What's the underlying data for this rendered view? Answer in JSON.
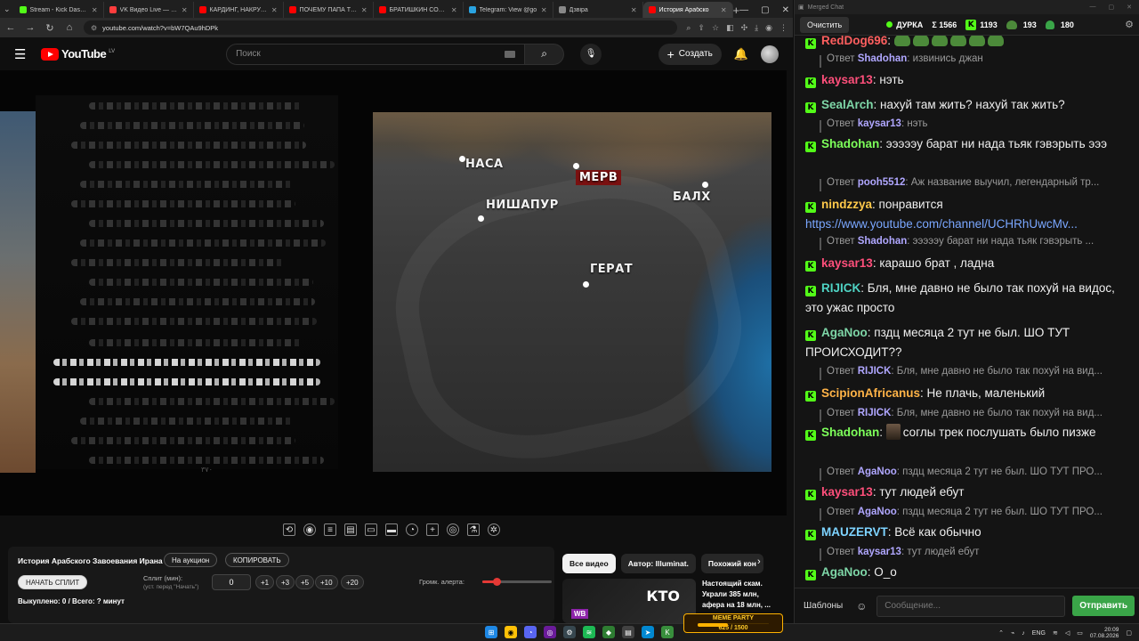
{
  "browser": {
    "tabs": [
      {
        "label": "Stream - Kick Dashboard",
        "color": "#53fc18"
      },
      {
        "label": "VK Видео Live — стрим",
        "color": "#ff3d3d"
      },
      {
        "label": "КАРДИНГ, НАКРУТКА",
        "color": "#ff0000"
      },
      {
        "label": "ПОЧЕМУ ПАПА ТЕБЯ",
        "color": "#ff0000"
      },
      {
        "label": "БРАТИШКИН СОЗДАЛ",
        "color": "#ff0000"
      },
      {
        "label": "Telegram: View @go",
        "color": "#2aa3e0"
      },
      {
        "label": "Дзвіра",
        "color": "#888888"
      },
      {
        "label": "История Арабско",
        "color": "#ff0000"
      }
    ],
    "url": "youtube.com/watch?v=bW7QAu9hDPk"
  },
  "youtube": {
    "logo_text": "YouTube",
    "region": "LV",
    "search_placeholder": "Поиск",
    "create_label": "Создать"
  },
  "video": {
    "cities": [
      {
        "name": "НАСА",
        "highlight": false
      },
      {
        "name": "МЕРВ",
        "highlight": true
      },
      {
        "name": "БАЛХ",
        "highlight": false
      },
      {
        "name": "НИШАПУР",
        "highlight": false
      },
      {
        "name": "ГЕРАТ",
        "highlight": false
      }
    ],
    "page_number": "٣٧٠"
  },
  "extension": {
    "title": "История Арабского Завоевания Ирана",
    "auction_label": "На аукцион",
    "copy_label": "КОПИРОВАТЬ",
    "start_split_label": "НАЧАТЬ СПЛИТ",
    "split_label": "Сплит (мин):",
    "split_hint": "(уст. перед \"Начать\")",
    "split_value": "0",
    "steps": [
      "+1",
      "+3",
      "+5",
      "+10",
      "+20"
    ],
    "alert_volume_label": "Громк. алерта:",
    "alert_volume_fraction": 0.2,
    "footer": "Выкуплено: 0 / Всего: ? минут"
  },
  "recommendations": {
    "chips": [
      "Все видео",
      "Автор: Illuminat.",
      "Похожий кон"
    ],
    "thumb_text": "КТО",
    "thumb_tag": "WB",
    "title": "Настоящий скам. Украли 385 млн, афера на 18 млн, ..."
  },
  "chat": {
    "window_title": "Merged Chat",
    "clear_label": "Очистить",
    "channel": "ДУРКА",
    "total": "Σ 1566",
    "kick_count": "1193",
    "frog_count": "193",
    "other_count": "180",
    "reply_label": "Ответ",
    "messages": [
      {
        "type": "msg",
        "user": "RedDog696",
        "color": "#ff5f5f",
        "text": "",
        "emotes": 6
      },
      {
        "type": "reply",
        "user": "Shadohan",
        "text": "извинись джан"
      },
      {
        "type": "msg",
        "user": "kaysar13",
        "color": "#ff4f7b",
        "text": "нэть"
      },
      {
        "type": "msg",
        "user": "SealArch",
        "color": "#7ed6a7",
        "text": "нахуй там жить? нахуй так жить?"
      },
      {
        "type": "reply",
        "user": "kaysar13",
        "text": "нэть"
      },
      {
        "type": "msg",
        "user": "Shadohan",
        "color": "#7dff5a",
        "text": "эээээу барат ни нада тьяк гэвэрыть эээ"
      },
      {
        "type": "reply",
        "user": "pooh5512",
        "text": "Аж название выучил, легендарный тр..."
      },
      {
        "type": "msg",
        "user": "nindzzya",
        "color": "#ffc94a",
        "text": "понравится",
        "link": "https://www.youtube.com/channel/UCHRhUwcMv..."
      },
      {
        "type": "reply",
        "user": "Shadohan",
        "text": "эээээу барат ни нада тьяк гэвэрыть ..."
      },
      {
        "type": "msg",
        "user": "kaysar13",
        "color": "#ff4f7b",
        "text": "карашо брат ,  ладна"
      },
      {
        "type": "msg",
        "user": "RIJICK",
        "color": "#4fd3c4",
        "text": "Бля, мне давно не было так похуй на видос, это ужас просто"
      },
      {
        "type": "msg",
        "user": "AgaNoo",
        "color": "#7ed6a7",
        "text": "пздц месяца 2 тут не был. ШО ТУТ ПРОИСХОДИТ??"
      },
      {
        "type": "reply",
        "user": "RIJICK",
        "text": "Бля, мне давно не было так похуй на вид..."
      },
      {
        "type": "msg",
        "user": "ScipionAfricanus",
        "color": "#ffb347",
        "text": "Не плачь, маленький"
      },
      {
        "type": "reply",
        "user": "RIJICK",
        "text": "Бля, мне давно не было так похуй на вид..."
      },
      {
        "type": "msg",
        "user": "Shadohan",
        "color": "#7dff5a",
        "text": "соглы трек послушать было пизже",
        "pfp": true
      },
      {
        "type": "reply",
        "user": "AgaNoo",
        "text": "пздц месяца 2 тут не был. ШО ТУТ ПРО..."
      },
      {
        "type": "msg",
        "user": "kaysar13",
        "color": "#ff4f7b",
        "text": "тут людей ебут"
      },
      {
        "type": "reply",
        "user": "AgaNoo",
        "text": "пздц месяца 2 тут не был. ШО ТУТ ПРО..."
      },
      {
        "type": "msg",
        "user": "MAUZERVT",
        "color": "#7dd3ff",
        "text": "Всё как обычно"
      },
      {
        "type": "reply",
        "user": "kaysar13",
        "text": "тут людей ебут"
      },
      {
        "type": "msg",
        "user": "AgaNoo",
        "color": "#7ed6a7",
        "text": "О_о"
      }
    ],
    "templates_label": "Шаблоны",
    "input_placeholder": "Сообщение...",
    "send_label": "Отправить"
  },
  "taskbar": {
    "meme_title": "MEME PARTY",
    "meme_progress": "625 / 1500",
    "meme_fraction": 0.42,
    "lang": "ENG",
    "time": "20:09",
    "date": "07.08.2026"
  }
}
